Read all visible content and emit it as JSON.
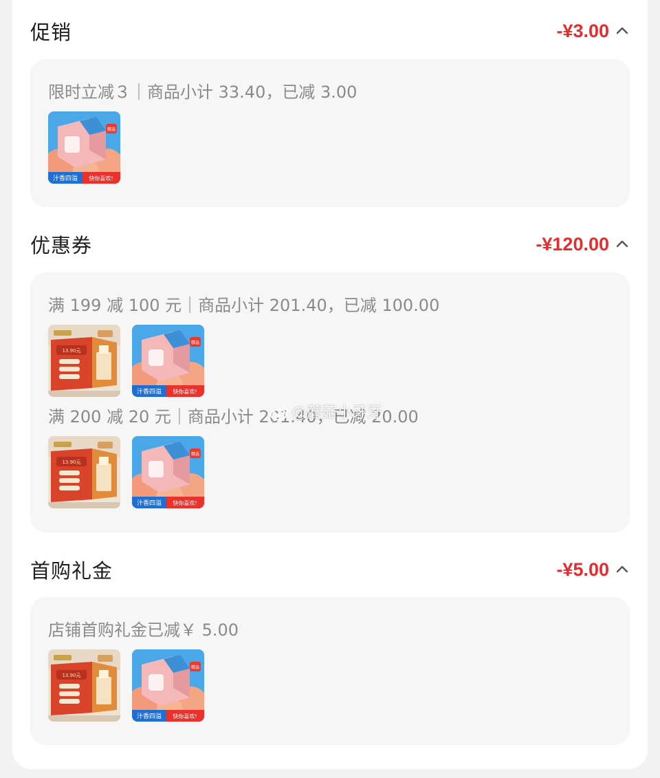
{
  "sections": [
    {
      "title": "促销",
      "amount": "-¥3.00",
      "rules": [
        {
          "text": "限时立减３｜商品小计 33.40，已减 3.00",
          "products": [
            "peach-juice-box"
          ]
        }
      ]
    },
    {
      "title": "优惠券",
      "amount": "-¥120.00",
      "rules": [
        {
          "text": "满 199 减 100 元｜商品小计 201.40，已减 100.00",
          "products": [
            "snack-gift-box",
            "peach-juice-box"
          ]
        },
        {
          "text": "满 200 减 20 元｜商品小计 201.40，已减 20.00",
          "products": [
            "snack-gift-box",
            "peach-juice-box"
          ]
        }
      ]
    },
    {
      "title": "首购礼金",
      "amount": "-¥5.00",
      "rules": [
        {
          "text": "店铺首购礼金已减￥ 5.00",
          "products": [
            "snack-gift-box",
            "peach-juice-box"
          ]
        }
      ]
    }
  ],
  "product_banners": {
    "peach_left": "汁香四溢",
    "peach_right": "快你喜欢!",
    "gift_line": "13.90元"
  },
  "watermark": "@蘑菇小牙牙",
  "colors": {
    "amount": "#e62c2c",
    "card": "#f6f6f6",
    "muted_text": "#8a8a8a"
  }
}
